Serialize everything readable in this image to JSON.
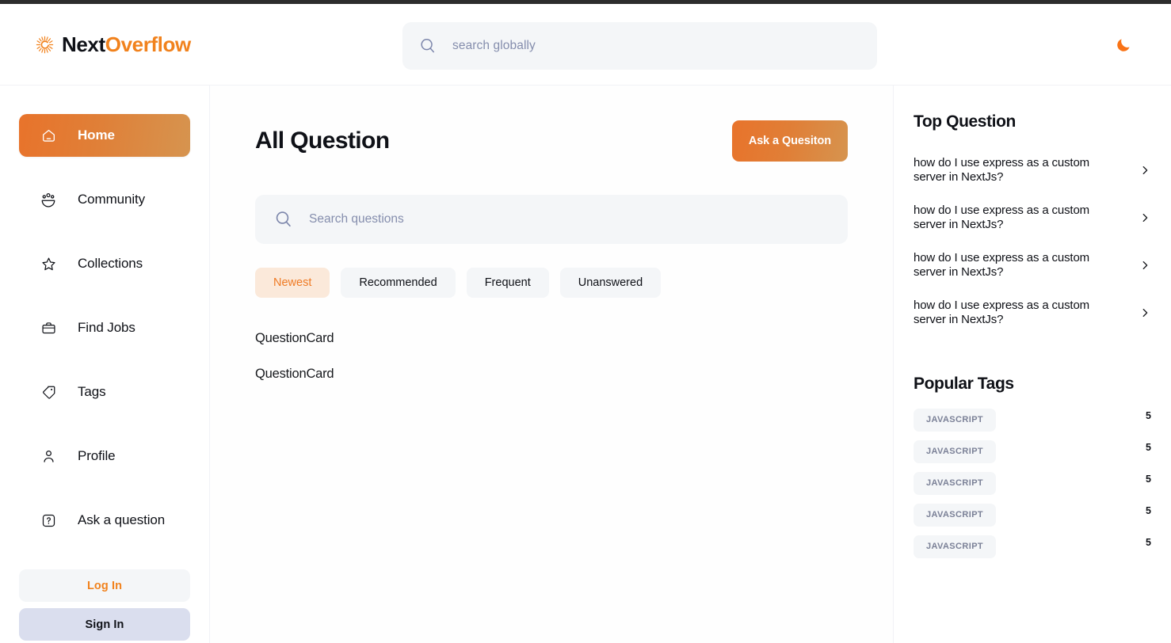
{
  "brand": {
    "logo_icon": "sun-burst-icon",
    "name_part1": "Next",
    "name_part2": "Overflow",
    "color_primary": "#f1821d",
    "color_dark": "#0f1117"
  },
  "navbar": {
    "search": {
      "icon": "search-icon",
      "placeholder": "search globally",
      "value": ""
    },
    "theme_toggle": {
      "icon": "moon-icon",
      "color": "#f97316"
    }
  },
  "sidebar": {
    "items": [
      {
        "label": "Home",
        "icon": "home-icon",
        "active": true
      },
      {
        "label": "Community",
        "icon": "people-icon",
        "active": false
      },
      {
        "label": "Collections",
        "icon": "star-icon",
        "active": false
      },
      {
        "label": "Find Jobs",
        "icon": "briefcase-icon",
        "active": false
      },
      {
        "label": "Tags",
        "icon": "tag-icon",
        "active": false
      },
      {
        "label": "Profile",
        "icon": "person-icon",
        "active": false
      },
      {
        "label": "Ask a question",
        "icon": "question-mark-icon",
        "active": false
      }
    ],
    "auth": {
      "login_label": "Log In",
      "signup_label": "Sign In"
    }
  },
  "main": {
    "title": "All Question",
    "ask_button_label": "Ask a Quesiton",
    "search": {
      "icon": "search-icon",
      "placeholder": "Search questions",
      "value": ""
    },
    "filters": [
      {
        "label": "Newest",
        "active": true
      },
      {
        "label": "Recommended",
        "active": false
      },
      {
        "label": "Frequent",
        "active": false
      },
      {
        "label": "Unanswered",
        "active": false
      }
    ],
    "questions": [
      {
        "label": "QuestionCard"
      },
      {
        "label": "QuestionCard"
      }
    ]
  },
  "right_sidebar": {
    "top_questions_title": "Top Question",
    "top_questions": [
      {
        "text": "how do I use express as a custom server in NextJs?",
        "chevron": "chevron-right-icon"
      },
      {
        "text": "how do I use express as a custom server in NextJs?",
        "chevron": "chevron-right-icon"
      },
      {
        "text": "how do I use express as a custom server in NextJs?",
        "chevron": "chevron-right-icon"
      },
      {
        "text": "how do I use express as a custom server in NextJs?",
        "chevron": "chevron-right-icon"
      }
    ],
    "popular_tags_title": "Popular Tags",
    "popular_tags": [
      {
        "name": "JAVASCRIPT",
        "count": "5"
      },
      {
        "name": "JAVASCRIPT",
        "count": "5"
      },
      {
        "name": "JAVASCRIPT",
        "count": "5"
      },
      {
        "name": "JAVASCRIPT",
        "count": "5"
      },
      {
        "name": "JAVASCRIPT",
        "count": "5"
      }
    ]
  }
}
